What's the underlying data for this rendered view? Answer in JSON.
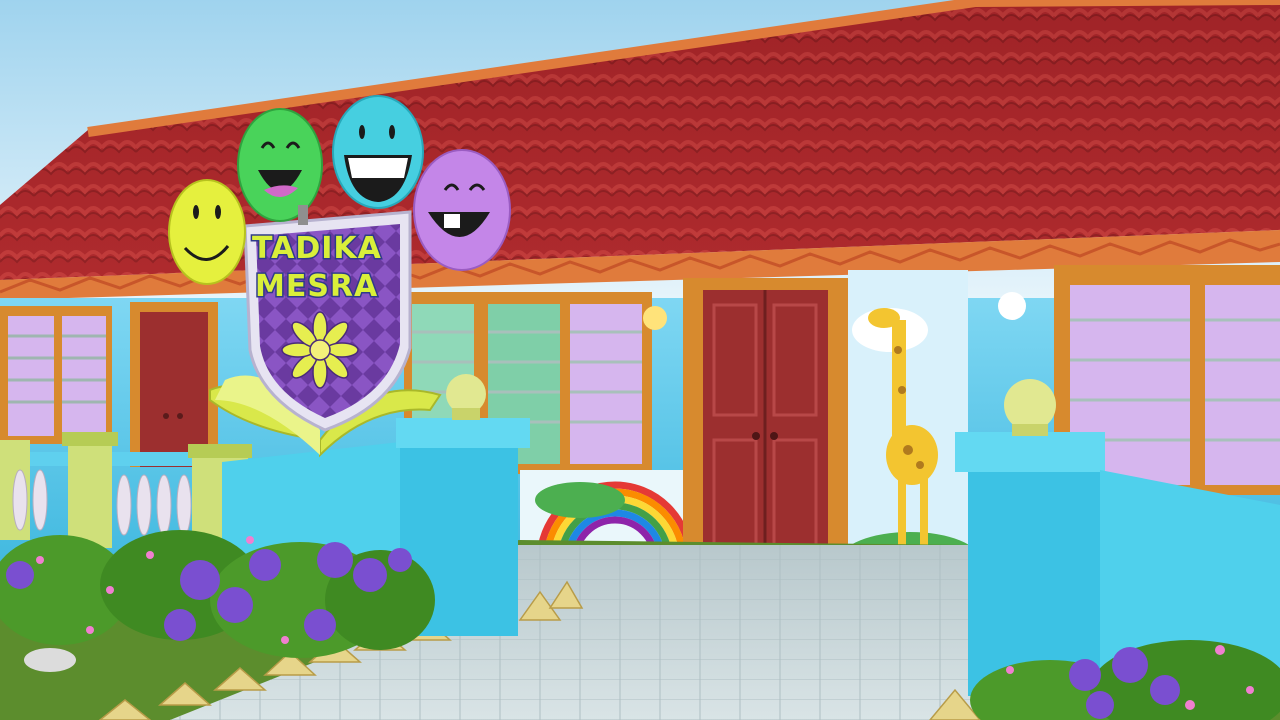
{
  "sign": {
    "line1": "TADIKA",
    "line2": "MESRA"
  },
  "colors": {
    "sky_top": "#a9d8ef",
    "roof": "#a9262a",
    "roof_trim": "#e07b3c",
    "wall_blue": "#53c9ea",
    "gate": "#4fd0ec",
    "door": "#9c2f2f",
    "window_frame": "#d78a2e",
    "curtain": "#d6b6ee",
    "shield": "#6a3aa0",
    "book": "#d9e84a",
    "path": "#c5d3d6",
    "grass": "#5c8d2d",
    "flower_purple": "#7a4fd0",
    "leaf": "#4c9a2a"
  },
  "smileys": [
    {
      "name": "yellow-smiley-icon",
      "color": "#e5f03e"
    },
    {
      "name": "green-smiley-icon",
      "color": "#49d35a"
    },
    {
      "name": "cyan-smiley-icon",
      "color": "#46cfe0"
    },
    {
      "name": "purple-smiley-icon",
      "color": "#c486e8"
    }
  ]
}
